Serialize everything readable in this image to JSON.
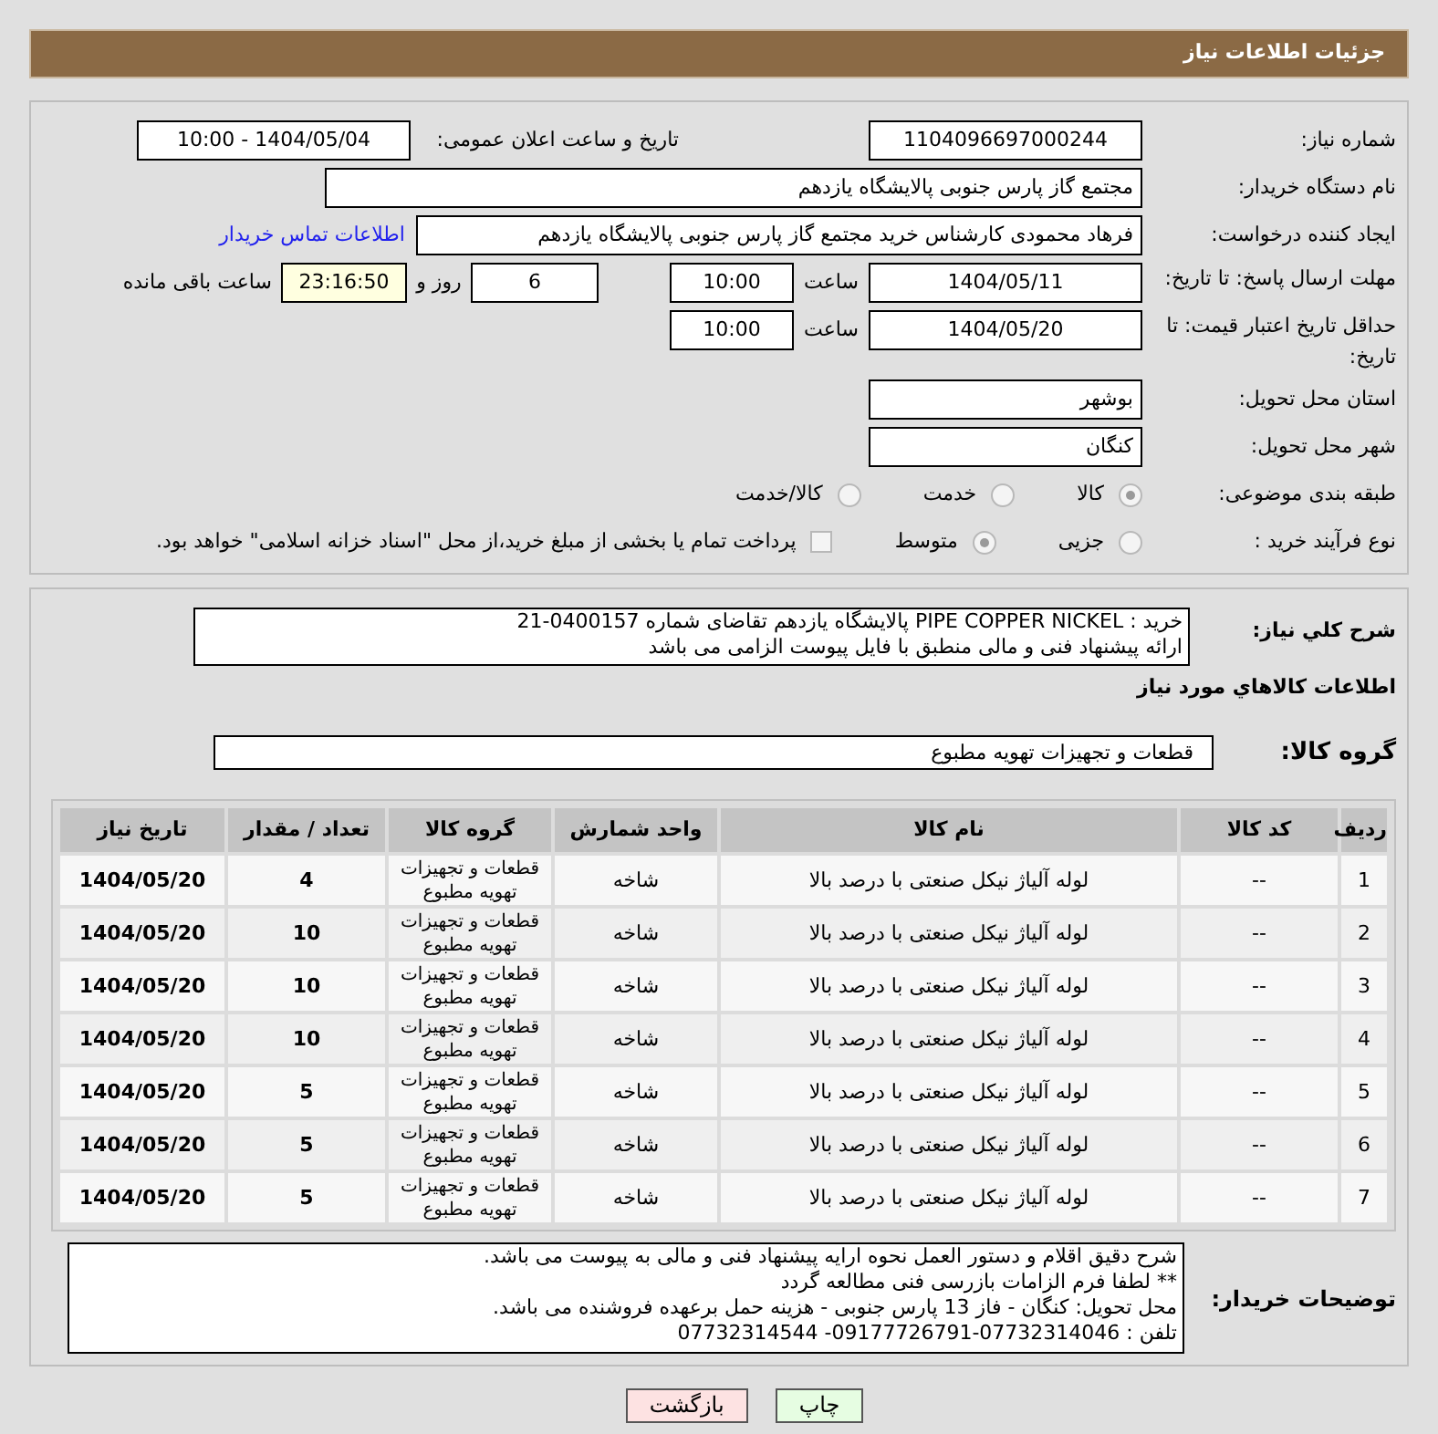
{
  "header": {
    "title": "جزئیات اطلاعات نیاز"
  },
  "need_number": {
    "label": "شماره نیاز:",
    "value": "1104096697000244"
  },
  "announce": {
    "label": "تاریخ و ساعت اعلان عمومی:",
    "value": "1404/05/04 - 10:00"
  },
  "buyer_org": {
    "label": "نام دستگاه خریدار:",
    "value": "مجتمع گاز پارس جنوبی  پالایشگاه یازدهم"
  },
  "requester": {
    "label": "ایجاد کننده درخواست:",
    "value": "فرهاد محمودی کارشناس خرید مجتمع گاز پارس جنوبی  پالایشگاه یازدهم",
    "link": "اطلاعات تماس خریدار"
  },
  "deadline": {
    "label": "مهلت ارسال پاسخ: تا تاریخ:",
    "date": "1404/05/11",
    "time_label": "ساعت",
    "time": "10:00",
    "days": "6",
    "days_label": "روز و",
    "remaining": "23:16:50",
    "remaining_label": "ساعت باقی مانده"
  },
  "price_validity": {
    "label": "حداقل تاریخ اعتبار قیمت: تا تاریخ:",
    "date": "1404/05/20",
    "time_label": "ساعت",
    "time": "10:00"
  },
  "province": {
    "label": "استان محل تحویل:",
    "value": "بوشهر"
  },
  "city": {
    "label": "شهر محل تحویل:",
    "value": "کنگان"
  },
  "category": {
    "label": "طبقه بندی موضوعی:",
    "options": [
      {
        "label": "کالا",
        "selected": true
      },
      {
        "label": "خدمت",
        "selected": false
      },
      {
        "label": "کالا/خدمت",
        "selected": false
      }
    ]
  },
  "process": {
    "label": "نوع فرآیند خرید :",
    "options": [
      {
        "label": "جزیی",
        "selected": false
      },
      {
        "label": "متوسط",
        "selected": true
      }
    ],
    "treasury": {
      "checked": false,
      "text": "پرداخت تمام یا بخشی از مبلغ خرید،از محل \"اسناد خزانه اسلامی\" خواهد بود."
    }
  },
  "description": {
    "label": "شرح کلي نياز:",
    "lines": [
      "خرید : PIPE COPPER NICKEL    پالایشگاه یازدهم تقاضای شماره 0400157-21",
      "ارائه پیشنهاد فنی و مالی منطبق با فایل پیوست الزامی می باشد"
    ]
  },
  "goods": {
    "title": "اطلاعات کالاهاي مورد نياز",
    "group_label": "گروه کالا:",
    "group": "قطعات و تجهیزات تهویه مطبوع",
    "columns": [
      "ردیف",
      "کد کالا",
      "نام کالا",
      "واحد شمارش",
      "گروه کالا",
      "تعداد / مقدار",
      "تاریخ نیاز"
    ],
    "rows": [
      [
        "1",
        "--",
        "لوله آلیاژ نیکل صنعتی با درصد بالا",
        "شاخه",
        "قطعات و تجهیزات تهویه مطبوع",
        "4",
        "1404/05/20"
      ],
      [
        "2",
        "--",
        "لوله آلیاژ نیکل صنعتی با درصد بالا",
        "شاخه",
        "قطعات و تجهیزات تهویه مطبوع",
        "10",
        "1404/05/20"
      ],
      [
        "3",
        "--",
        "لوله آلیاژ نیکل صنعتی با درصد بالا",
        "شاخه",
        "قطعات و تجهیزات تهویه مطبوع",
        "10",
        "1404/05/20"
      ],
      [
        "4",
        "--",
        "لوله آلیاژ نیکل صنعتی با درصد بالا",
        "شاخه",
        "قطعات و تجهیزات تهویه مطبوع",
        "10",
        "1404/05/20"
      ],
      [
        "5",
        "--",
        "لوله آلیاژ نیکل صنعتی با درصد بالا",
        "شاخه",
        "قطعات و تجهیزات تهویه مطبوع",
        "5",
        "1404/05/20"
      ],
      [
        "6",
        "--",
        "لوله آلیاژ نیکل صنعتی با درصد بالا",
        "شاخه",
        "قطعات و تجهیزات تهویه مطبوع",
        "5",
        "1404/05/20"
      ],
      [
        "7",
        "--",
        "لوله آلیاژ نیکل صنعتی با درصد بالا",
        "شاخه",
        "قطعات و تجهیزات تهویه مطبوع",
        "5",
        "1404/05/20"
      ]
    ]
  },
  "buyer_notes": {
    "label": "توضیحات خریدار:",
    "lines": [
      "شرح دقیق اقلام و دستور العمل نحوه ارایه پیشنهاد فنی و مالی به پیوست می باشد.",
      "** لطفا فرم الزامات بازرسی فنی مطالعه گردد",
      "محل تحویل: کنگان - فاز 13 پارس جنوبی - هزینه حمل برعهده فروشنده می باشد.",
      "تلفن : 07732314046-09177726791- 07732314544"
    ]
  },
  "buttons": [
    {
      "label": "چاپ",
      "kind": "print"
    },
    {
      "label": "بازگشت",
      "kind": "back"
    }
  ]
}
